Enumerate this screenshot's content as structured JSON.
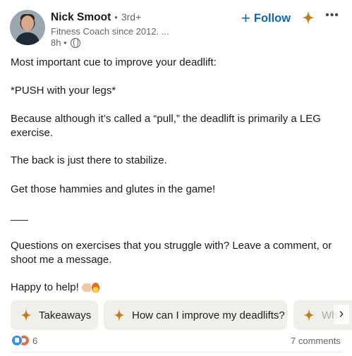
{
  "author": {
    "name": "Nick Smoot",
    "separator": "•",
    "degree": "3rd+",
    "headline": "Fitness Coach since 2012. ...",
    "time": "8h •"
  },
  "actions": {
    "follow_plus": "+",
    "follow_label": "Follow",
    "more_label": "•••"
  },
  "post": {
    "line1": "Most important cue to improve your deadlift:",
    "line2": "*PUSH with your legs*",
    "line3": "Because although it’s called a “pull,” the deadlift is primarily a LEG exercise.",
    "line4": "The back is just there to stabilize.",
    "line5": "Get those hammies and glutes in the game!",
    "line6": "___",
    "line7": "Questions on exercises that you struggle with? Leave a comment, or shoot me a message.",
    "line8": "Happy to help!"
  },
  "suggestions": [
    {
      "label": "Takeaways"
    },
    {
      "label": "How can I improve my deadlifts?"
    },
    {
      "label": "Wh"
    }
  ],
  "suggestions_next": "›",
  "footer": {
    "reaction_count": "6",
    "comments": "7 comments"
  },
  "icons": {
    "spark_color": "#c37d16",
    "accent": "#0a66c2"
  }
}
